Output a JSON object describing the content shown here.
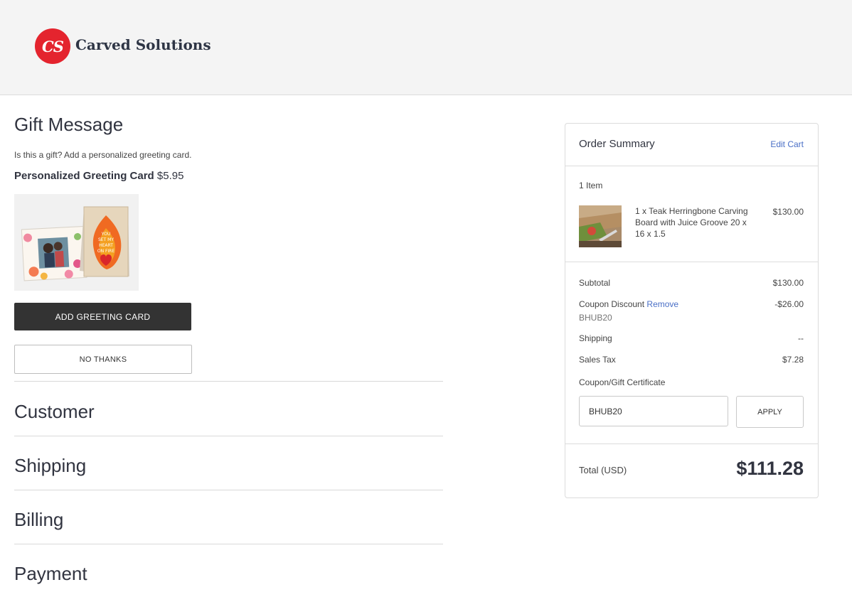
{
  "brand": {
    "logo_initials": "CS",
    "name": "Carved Solutions",
    "color": "#e4242e"
  },
  "gift": {
    "heading": "Gift Message",
    "question": "Is this a gift? Add a personalized greeting card.",
    "card_label": "Personalized Greeting Card",
    "card_price": "$5.95",
    "card_image_text": "YOU SET MY HEART ON FIRE",
    "add_button": "ADD GREETING CARD",
    "no_button": "NO THANKS"
  },
  "steps": [
    "Customer",
    "Shipping",
    "Billing",
    "Payment"
  ],
  "summary": {
    "title": "Order Summary",
    "edit_link": "Edit Cart",
    "item_count": "1 Item",
    "item": {
      "name": "1 x Teak Herringbone Carving Board with Juice Groove 20 x 16 x 1.5",
      "price": "$130.00"
    },
    "subtotal_label": "Subtotal",
    "subtotal": "$130.00",
    "coupon_label": "Coupon Discount",
    "coupon_remove": "Remove",
    "coupon_value": "-$26.00",
    "coupon_code": "BHUB20",
    "shipping_label": "Shipping",
    "shipping": "--",
    "tax_label": "Sales Tax",
    "tax": "$7.28",
    "coupon_field_label": "Coupon/Gift Certificate",
    "coupon_input_value": "BHUB20",
    "apply_button": "APPLY",
    "total_label": "Total (USD)",
    "total": "$111.28"
  },
  "colors": {
    "link": "#4a6fc6",
    "dark_button": "#333333",
    "header_bg": "#f4f4f4"
  }
}
